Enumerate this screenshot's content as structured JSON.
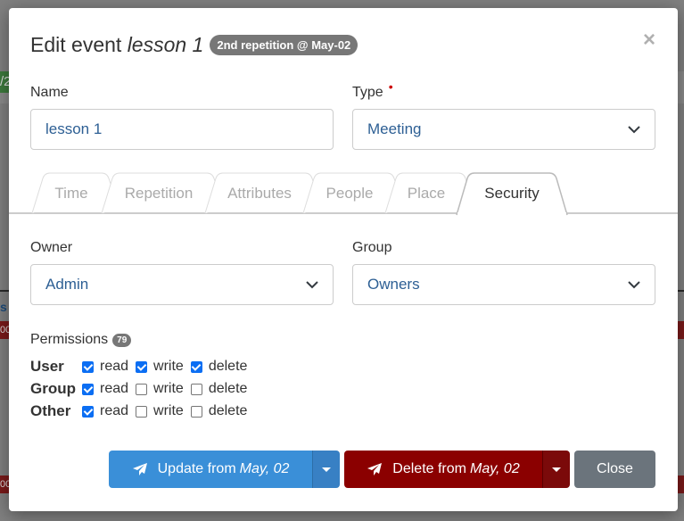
{
  "background": {
    "green_fragment": "/2",
    "blue_fragment": "s",
    "red_fragment_1": "00",
    "red_fragment_2": "00"
  },
  "modal": {
    "title_prefix": "Edit event",
    "title_event": "lesson 1",
    "badge": "2nd repetition @ May-02",
    "close_symbol": "×"
  },
  "fields": {
    "name_label": "Name",
    "name_value": "lesson 1",
    "type_label": "Type",
    "type_required": "•",
    "type_value": "Meeting",
    "owner_label": "Owner",
    "owner_value": "Admin",
    "group_label": "Group",
    "group_value": "Owners"
  },
  "tabs": [
    {
      "label": "Time"
    },
    {
      "label": "Repetition"
    },
    {
      "label": "Attributes"
    },
    {
      "label": "People"
    },
    {
      "label": "Place"
    },
    {
      "label": "Security"
    }
  ],
  "active_tab": "Security",
  "permissions": {
    "title": "Permissions",
    "count": "79",
    "rows": [
      {
        "name": "User",
        "read": true,
        "write": true,
        "delete": true
      },
      {
        "name": "Group",
        "read": true,
        "write": false,
        "delete": false
      },
      {
        "name": "Other",
        "read": true,
        "write": false,
        "delete": false
      }
    ],
    "labels": {
      "read": "read",
      "write": "write",
      "delete": "delete"
    }
  },
  "buttons": {
    "update_prefix": "Update from",
    "update_date": "May, 02",
    "delete_prefix": "Delete from",
    "delete_date": "May, 02",
    "close": "Close"
  },
  "colors": {
    "primary": "#3a8fd8",
    "danger": "#8b0000",
    "secondary": "#6b747c",
    "checkbox": "#0b6ef3"
  },
  "icons": {
    "update": "paper-plane-icon",
    "delete": "paper-plane-icon",
    "select": "chevron-down-icon",
    "split": "caret-down-icon"
  }
}
